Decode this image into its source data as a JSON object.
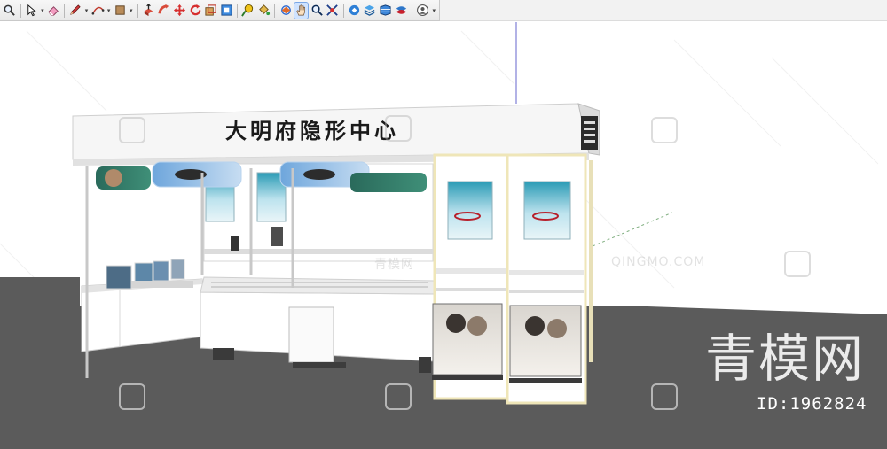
{
  "toolbar": {
    "tools": [
      {
        "icon": "zoom-icon"
      },
      {
        "icon": "select-arrow-icon",
        "dropdown": true
      },
      {
        "icon": "eraser-icon"
      },
      {
        "icon": "pencil-line-icon",
        "dropdown": true
      },
      {
        "icon": "arc-icon",
        "dropdown": true
      },
      {
        "icon": "rectangle-shape-icon",
        "dropdown": true
      },
      {
        "icon": "push-pull-icon"
      },
      {
        "icon": "follow-me-icon"
      },
      {
        "icon": "move-icon"
      },
      {
        "icon": "rotate-icon"
      },
      {
        "icon": "scale-icon"
      },
      {
        "icon": "offset-icon"
      },
      {
        "icon": "tape-measure-icon"
      },
      {
        "icon": "paint-bucket-icon"
      },
      {
        "icon": "orbit-icon"
      },
      {
        "icon": "pan-icon",
        "active": true
      },
      {
        "icon": "zoom-window-icon"
      },
      {
        "icon": "zoom-extents-icon"
      },
      {
        "icon": "warehouse-icon"
      },
      {
        "icon": "layers-icon"
      },
      {
        "icon": "components-icon"
      },
      {
        "icon": "extension-icon"
      },
      {
        "icon": "user-account-icon",
        "dropdown": true
      }
    ]
  },
  "scene": {
    "sign_text": "大明府隐形中心",
    "side_sign_text": "大明府隐形中心",
    "cabinet_count": 2
  },
  "watermark": {
    "brand": "青模网",
    "id_label": "ID:1962824",
    "web": "QINGMO.COM",
    "faint_cn": "青模网"
  },
  "colors": {
    "ground": "#5b5b5b",
    "panel_teal": "#2f6e60",
    "accent_blue": "#2f7fd0",
    "sign_white": "#f6f6f6"
  }
}
